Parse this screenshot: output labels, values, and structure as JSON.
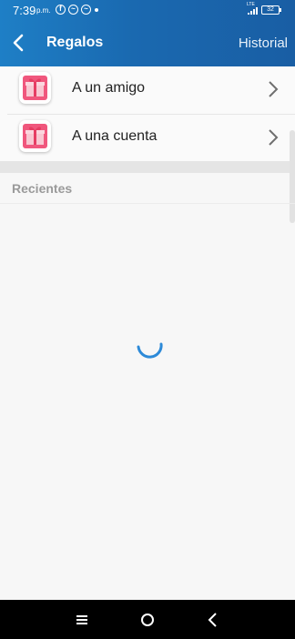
{
  "status_bar": {
    "time": "7:39",
    "ampm": "p.m.",
    "network": "LTE",
    "battery": "32"
  },
  "header": {
    "title": "Regalos",
    "history_label": "Historial"
  },
  "options": [
    {
      "label": "A un amigo",
      "icon": "gift-icon"
    },
    {
      "label": "A una cuenta",
      "icon": "gift-icon"
    }
  ],
  "recents": {
    "title": "Recientes"
  },
  "colors": {
    "header_start": "#1e7fc6",
    "header_end": "#195ea4",
    "spinner": "#2d8ad8",
    "gift_pink": "#f0577d"
  },
  "nav": {
    "icons": [
      "menu-icon",
      "home-icon",
      "back-icon"
    ]
  }
}
